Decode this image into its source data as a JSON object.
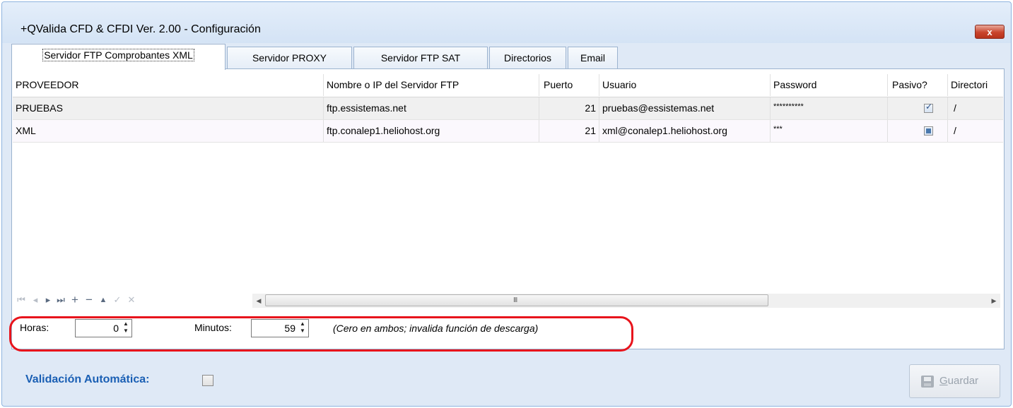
{
  "window": {
    "title": "+QValida CFD & CFDI Ver. 2.00 - Configuración",
    "close_label": "x"
  },
  "tabs": [
    {
      "label": "Servidor  FTP Comprobantes XML",
      "active": true
    },
    {
      "label": "Servidor PROXY",
      "active": false
    },
    {
      "label": "Servidor FTP SAT",
      "active": false
    },
    {
      "label": "Directorios",
      "active": false
    },
    {
      "label": "Email",
      "active": false
    }
  ],
  "grid": {
    "columns": [
      "PROVEEDOR",
      "Nombre o IP del Servidor FTP",
      "Puerto",
      "Usuario",
      "Password",
      "Pasivo?",
      "Directori"
    ],
    "rows": [
      {
        "proveedor": "PRUEBAS",
        "servidor": "ftp.essistemas.net",
        "puerto": "21",
        "usuario": "pruebas@essistemas.net",
        "password": "**********",
        "pasivo": "checked",
        "directorio": "/"
      },
      {
        "proveedor": "XML",
        "servidor": "ftp.conalep1.heliohost.org",
        "puerto": "21",
        "usuario": "xml@conalep1.heliohost.org",
        "password": "***",
        "pasivo": "indeterminate",
        "directorio": "/"
      }
    ],
    "nav_icons": [
      "first-icon",
      "prev-icon",
      "next-icon",
      "last-icon",
      "add-icon",
      "delete-icon",
      "up-icon",
      "post-icon",
      "cancel-icon"
    ],
    "scroll_grip": "III"
  },
  "timer": {
    "horas_label": "Horas:",
    "horas_value": "0",
    "minutos_label": "Minutos:",
    "minutos_value": "59",
    "note": "(Cero en ambos; invalida función de descarga)"
  },
  "footer": {
    "validacion_label": "Validación Automática:",
    "validacion_checked": false,
    "guardar_first": "G",
    "guardar_rest": "uardar",
    "guardar_enabled": false
  },
  "colors": {
    "annotation": "#e8141c",
    "label_blue": "#1a5fb4",
    "close_button": "#c9442c"
  }
}
